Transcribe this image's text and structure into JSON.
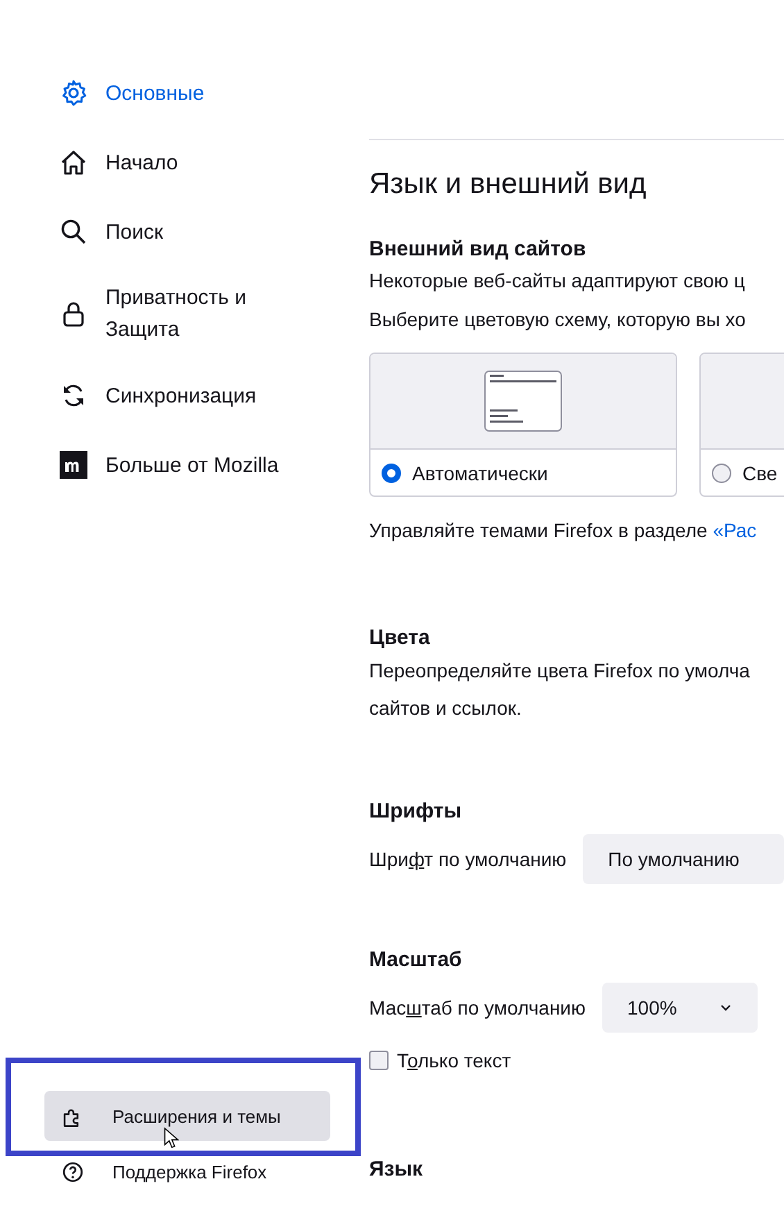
{
  "sidebar": {
    "items": [
      {
        "kind": "gear",
        "label": "Основные",
        "selected": true
      },
      {
        "kind": "home",
        "label": "Начало",
        "selected": false
      },
      {
        "kind": "search",
        "label": "Поиск",
        "selected": false
      },
      {
        "kind": "lock",
        "label": "Приватность и Защита",
        "selected": false
      },
      {
        "kind": "sync",
        "label": "Синхронизация",
        "selected": false
      },
      {
        "kind": "mozilla",
        "label": "Больше от Mozilla",
        "selected": false
      }
    ],
    "footer_items": [
      {
        "kind": "puzzle",
        "label": "Расширения и темы",
        "highlighted": true
      },
      {
        "kind": "help",
        "label": "Поддержка Firefox",
        "highlighted": false
      }
    ]
  },
  "main": {
    "title": "Язык и внешний вид",
    "appearance": {
      "heading": "Внешний вид сайтов",
      "lines": [
        "Некоторые веб-сайты адаптируют свою ц",
        "Выберите цветовую схему, которую вы хо"
      ],
      "options": [
        {
          "label": "Автоматически",
          "selected": true
        },
        {
          "label": "Све",
          "selected": false
        }
      ],
      "note": "Управляйте темами Firefox в разделе ",
      "note_link": "«Рас"
    },
    "colors": {
      "heading": "Цвета",
      "text": "Переопределяйте цвета Firefox по умолча сайтов и ссылок."
    },
    "fonts": {
      "heading": "Шрифты",
      "label": {
        "before": "Шри",
        "key": "ф",
        "after": "т по умолчанию"
      },
      "value": "По умолчанию"
    },
    "zoom": {
      "heading": "Масштаб",
      "label": {
        "before": "Мас",
        "key": "ш",
        "after": "таб по умолчанию"
      },
      "value": "100%",
      "text_only": {
        "label": {
          "before": "Т",
          "key": "о",
          "after": "лько текст"
        },
        "checked": false
      }
    },
    "language": {
      "heading": "Язык"
    }
  }
}
